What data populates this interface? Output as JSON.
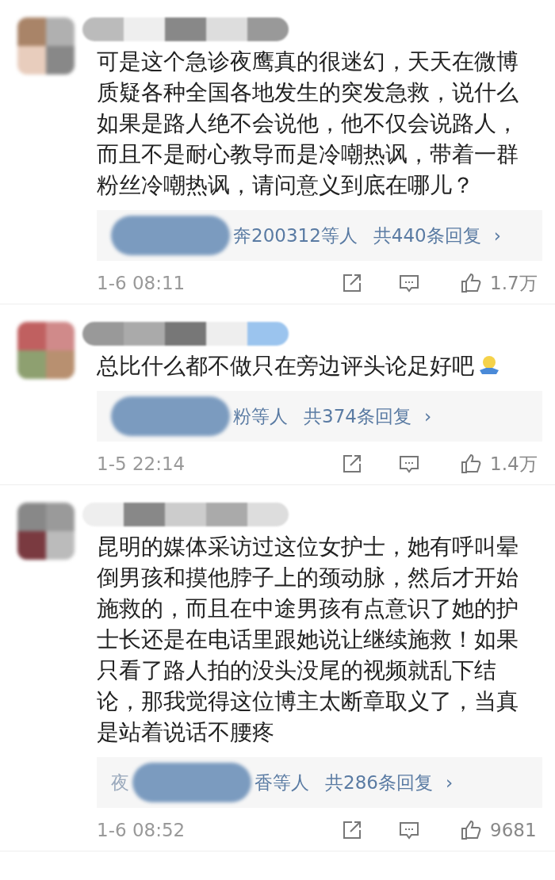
{
  "comments": [
    {
      "text": "可是这个急诊夜鹰真的很迷幻，天天在微博质疑各种全国各地发生的突发急救，说什么如果是路人绝不会说他，他不仅会说路人，而且不是耐心教导而是冷嘲热讽，带着一群粉丝冷嘲热讽，请问意义到底在哪儿？",
      "emoji": false,
      "replies": {
        "names": "奔200312等人",
        "count": "共440条回复",
        "chevron": "›"
      },
      "time": "1-6 08:11",
      "likes": "1.7万"
    },
    {
      "text": "总比什么都不做只在旁边评头论足好吧",
      "emoji": true,
      "replies": {
        "names": "粉等人",
        "count": "共374条回复",
        "chevron": "›"
      },
      "time": "1-5 22:14",
      "likes": "1.4万"
    },
    {
      "text": "昆明的媒体采访过这位女护士，她有呼叫晕倒男孩和摸他脖子上的颈动脉，然后才开始施救的，而且在中途男孩有点意识了她的护士长还是在电话里跟她说让继续施救！如果只看了路人拍的没头没尾的视频就乱下结论，那我觉得这位博主太断章取义了，当真是站着说话不腰疼",
      "emoji": false,
      "replies": {
        "lead": "夜",
        "names": "香等人",
        "count": "共286条回复",
        "chevron": "›"
      },
      "time": "1-6 08:52",
      "likes": "9681"
    }
  ]
}
